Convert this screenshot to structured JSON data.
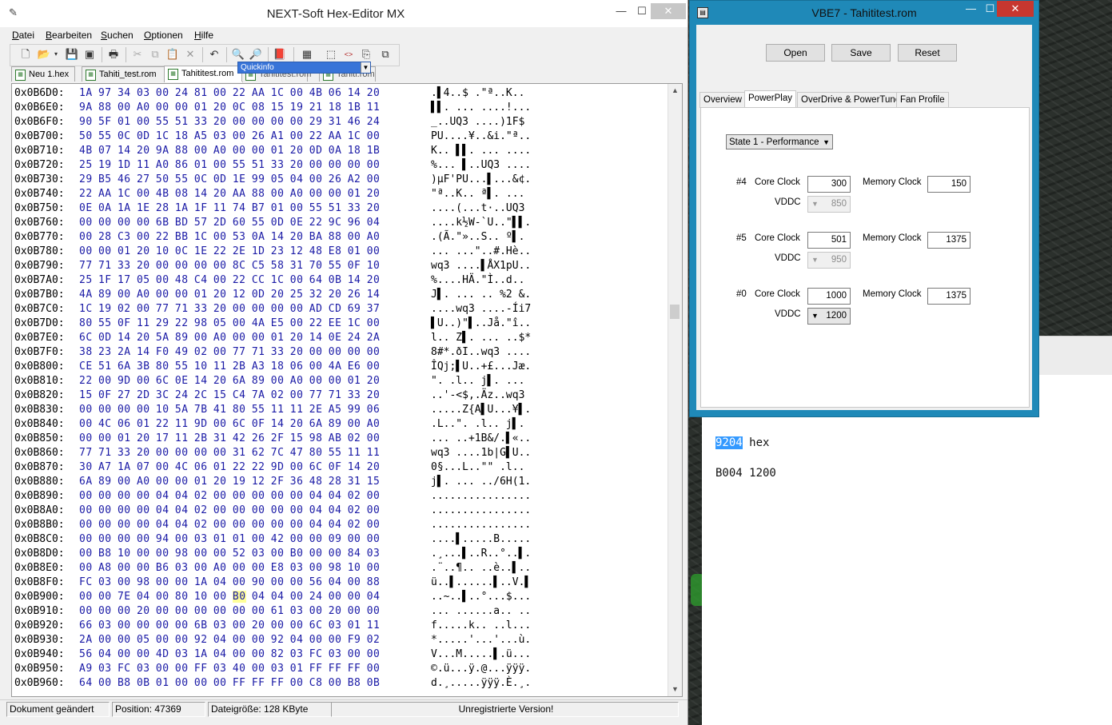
{
  "hex_editor": {
    "title": "NEXT-Soft Hex-Editor MX",
    "menu": [
      "Datei",
      "Bearbeiten",
      "Suchen",
      "Optionen",
      "Hilfe"
    ],
    "quickinfo_label": "Quickinfo",
    "tabs": [
      "Neu 1.hex",
      "Tahiti_test.rom",
      "Tahititest.rom",
      "Tahititest.rom",
      "Tahiti.rom"
    ],
    "rows": [
      {
        "addr": "0x0B6D0:",
        "bytes": "1A 97 34 03 00 24 81 00 22 AA 1C 00 4B 06 14 20",
        "ascii": ".▌4..$ .\"ª..K.."
      },
      {
        "addr": "0x0B6E0:",
        "bytes": "9A 88 00 A0 00 00 01 20 0C 08 15 19 21 18 1B 11",
        "ascii": "▌▌. ... ....!..."
      },
      {
        "addr": "0x0B6F0:",
        "bytes": "90 5F 01 00 55 51 33 20 00 00 00 00 29 31 46 24",
        "ascii": "_..UQ3 ....)1F$"
      },
      {
        "addr": "0x0B700:",
        "bytes": "50 55 0C 0D 1C 18 A5 03 00 26 A1 00 22 AA 1C 00",
        "ascii": "PU....¥..&i.\"ª.."
      },
      {
        "addr": "0x0B710:",
        "bytes": "4B 07 14 20 9A 88 00 A0 00 00 01 20 0D 0A 18 1B",
        "ascii": "K.. ▌▌. ... ...."
      },
      {
        "addr": "0x0B720:",
        "bytes": "25 19 1D 11 A0 86 01 00 55 51 33 20 00 00 00 00",
        "ascii": "%... ▌..UQ3 ...."
      },
      {
        "addr": "0x0B730:",
        "bytes": "29 B5 46 27 50 55 0C 0D 1E 99 05 04 00 26 A2 00",
        "ascii": ")µF'PU...▌...&¢."
      },
      {
        "addr": "0x0B740:",
        "bytes": "22 AA 1C 00 4B 08 14 20 AA 88 00 A0 00 00 01 20",
        "ascii": "\"ª..K.. ª▌. ... "
      },
      {
        "addr": "0x0B750:",
        "bytes": "0E 0A 1A 1E 28 1A 1F 11 74 B7 01 00 55 51 33 20",
        "ascii": "....(...t·..UQ3 "
      },
      {
        "addr": "0x0B760:",
        "bytes": "00 00 00 00 6B BD 57 2D 60 55 0D 0E 22 9C 96 04",
        "ascii": "....k½W-`U..\"▌▌."
      },
      {
        "addr": "0x0B770:",
        "bytes": "00 28 C3 00 22 BB 1C 00 53 0A 14 20 BA 88 00 A0",
        "ascii": ".(Ã.\"»..S.. º▌. "
      },
      {
        "addr": "0x0B780:",
        "bytes": "00 00 01 20 10 0C 1E 22 2E 1D 23 12 48 E8 01 00",
        "ascii": "... ...\"..#.Hè.."
      },
      {
        "addr": "0x0B790:",
        "bytes": "77 71 33 20 00 00 00 00 8C C5 58 31 70 55 0F 10",
        "ascii": "wq3 ....▌ÅX1pU.."
      },
      {
        "addr": "0x0B7A0:",
        "bytes": "25 1F 17 05 00 48 C4 00 22 CC 1C 00 64 0B 14 20",
        "ascii": "%....HÄ.\"Ì..d.. "
      },
      {
        "addr": "0x0B7B0:",
        "bytes": "4A 89 00 A0 00 00 01 20 12 0D 20 25 32 20 26 14",
        "ascii": "J▌. ... .. %2 &."
      },
      {
        "addr": "0x0B7C0:",
        "bytes": "1C 19 02 00 77 71 33 20 00 00 00 00 AD CD 69 37",
        "ascii": "....wq3 ....-Íi7"
      },
      {
        "addr": "0x0B7D0:",
        "bytes": "80 55 0F 11 29 22 98 05 00 4A E5 00 22 EE 1C 00",
        "ascii": "▌U..)\"▌..Jå.\"î.."
      },
      {
        "addr": "0x0B7E0:",
        "bytes": "6C 0D 14 20 5A 89 00 A0 00 00 01 20 14 0E 24 2A",
        "ascii": "l.. Z▌. ... ..$*"
      },
      {
        "addr": "0x0B7F0:",
        "bytes": "38 23 2A 14 F0 49 02 00 77 71 33 20 00 00 00 00",
        "ascii": "8#*.ðI..wq3 ...."
      },
      {
        "addr": "0x0B800:",
        "bytes": "CE 51 6A 3B 80 55 10 11 2B A3 18 06 00 4A E6 00",
        "ascii": "ÎQj;▌U..+£...Jæ."
      },
      {
        "addr": "0x0B810:",
        "bytes": "22 00 9D 00 6C 0E 14 20 6A 89 00 A0 00 00 01 20",
        "ascii": "\". .l.. j▌. ... "
      },
      {
        "addr": "0x0B820:",
        "bytes": "15 0F 27 2D 3C 24 2C 15 C4 7A 02 00 77 71 33 20",
        "ascii": "..'-<$,.Äz..wq3 "
      },
      {
        "addr": "0x0B830:",
        "bytes": "00 00 00 00 10 5A 7B 41 80 55 11 11 2E A5 99 06",
        "ascii": ".....Z{A▌U...¥▌."
      },
      {
        "addr": "0x0B840:",
        "bytes": "00 4C 06 01 22 11 9D 00 6C 0F 14 20 6A 89 00 A0",
        "ascii": ".L..\". .l.. j▌. "
      },
      {
        "addr": "0x0B850:",
        "bytes": "00 00 01 20 17 11 2B 31 42 26 2F 15 98 AB 02 00",
        "ascii": "... ..+1B&/.▌«.."
      },
      {
        "addr": "0x0B860:",
        "bytes": "77 71 33 20 00 00 00 00 31 62 7C 47 80 55 11 11",
        "ascii": "wq3 ....1b|G▌U.."
      },
      {
        "addr": "0x0B870:",
        "bytes": "30 A7 1A 07 00 4C 06 01 22 22 9D 00 6C 0F 14 20",
        "ascii": "0§...L..\"\" .l.. "
      },
      {
        "addr": "0x0B880:",
        "bytes": "6A 89 00 A0 00 00 01 20 19 12 2F 36 48 28 31 15",
        "ascii": "j▌. ... ../6H(1."
      },
      {
        "addr": "0x0B890:",
        "bytes": "00 00 00 00 04 04 02 00 00 00 00 00 04 04 02 00",
        "ascii": "................"
      },
      {
        "addr": "0x0B8A0:",
        "bytes": "00 00 00 00 04 04 02 00 00 00 00 00 04 04 02 00",
        "ascii": "................"
      },
      {
        "addr": "0x0B8B0:",
        "bytes": "00 00 00 00 04 04 02 00 00 00 00 00 04 04 02 00",
        "ascii": "................"
      },
      {
        "addr": "0x0B8C0:",
        "bytes": "00 00 00 00 94 00 03 01 01 00 42 00 00 09 00 00",
        "ascii": "....▌.....B....."
      },
      {
        "addr": "0x0B8D0:",
        "bytes": "00 B8 10 00 00 98 00 00 52 03 00 B0 00 00 84 03",
        "ascii": ".¸...▌..R..°..▌."
      },
      {
        "addr": "0x0B8E0:",
        "bytes": "00 A8 00 00 B6 03 00 A0 00 00 E8 03 00 98 10 00",
        "ascii": ".¨..¶.. ..è..▌.."
      },
      {
        "addr": "0x0B8F0:",
        "bytes": "FC 03 00 98 00 00 1A 04 00 90 00 00 56 04 00 88",
        "ascii": "ü..▌......▌..V.▌"
      },
      {
        "addr": "0x0B900:",
        "bytes": "00 00 7E 04 00 80 10 00 B0 04 04 00 24 00 00 04",
        "ascii": "..~..▌..°...$...",
        "hl": 8
      },
      {
        "addr": "0x0B910:",
        "bytes": "00 00 00 20 00 00 00 00 00 00 61 03 00 20 00 00",
        "ascii": "... ......a.. .."
      },
      {
        "addr": "0x0B920:",
        "bytes": "66 03 00 00 00 00 6B 03 00 20 00 00 6C 03 01 11",
        "ascii": "f.....k.. ..l..."
      },
      {
        "addr": "0x0B930:",
        "bytes": "2A 00 00 05 00 00 92 04 00 00 92 04 00 00 F9 02",
        "ascii": "*.....'...'...ù."
      },
      {
        "addr": "0x0B940:",
        "bytes": "56 04 00 00 4D 03 1A 04 00 00 82 03 FC 03 00 00",
        "ascii": "V...M.....▌.ü..."
      },
      {
        "addr": "0x0B950:",
        "bytes": "A9 03 FC 03 00 00 FF 03 40 00 03 01 FF FF FF 00",
        "ascii": "©.ü...ÿ.@...ÿÿÿ."
      },
      {
        "addr": "0x0B960:",
        "bytes": "64 00 B8 0B 01 00 00 00 FF FF FF 00 C8 00 B8 0B",
        "ascii": "d.¸.....ÿÿÿ.È.¸."
      }
    ],
    "status": {
      "modified": "Dokument geändert",
      "position": "Position: 47369",
      "filesize": "Dateigröße: 128 KByte",
      "version": "Unregistrierte Version!"
    }
  },
  "vbe7": {
    "title": "VBE7 - Tahititest.rom",
    "buttons": {
      "open": "Open",
      "save": "Save",
      "reset": "Reset"
    },
    "tabs": [
      "Overview",
      "PowerPlay",
      "OverDrive & PowerTune",
      "Fan Profile"
    ],
    "active_tab": "PowerPlay",
    "state_select": "State 1 - Performance",
    "labels": {
      "core": "Core Clock",
      "memory": "Memory Clock",
      "vddc": "VDDC"
    },
    "states": [
      {
        "id": "#4",
        "core": "300",
        "memory": "150",
        "vddc": "850",
        "vddc_enabled": false
      },
      {
        "id": "#5",
        "core": "501",
        "memory": "1375",
        "vddc": "950",
        "vddc_enabled": false
      },
      {
        "id": "#0",
        "core": "1000",
        "memory": "1375",
        "vddc": "1200",
        "vddc_enabled": true
      }
    ]
  },
  "notepad": {
    "line1_selected": "9204",
    "line1_rest": " hex",
    "line2": "B004 1200"
  },
  "colors": {
    "vbe_frame": "#1f89b8",
    "hex_bytes": "#1a1aa6",
    "highlight": "#ffff99",
    "selection": "#3399ff"
  }
}
